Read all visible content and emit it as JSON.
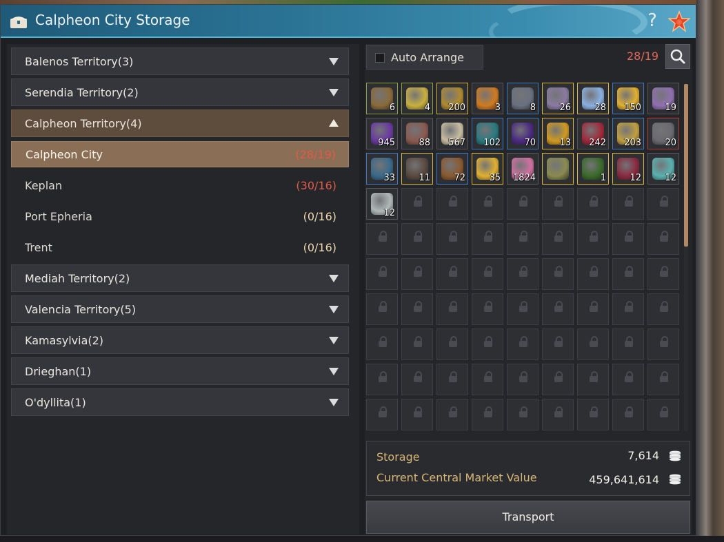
{
  "window": {
    "title": "Calpheon City Storage",
    "help_label": "?"
  },
  "territories": [
    {
      "label": "Balenos Territory(3)",
      "open": false
    },
    {
      "label": "Serendia Territory(2)",
      "open": false
    },
    {
      "label": "Calpheon Territory(4)",
      "open": true,
      "towns": [
        {
          "label": "Calpheon City",
          "count": "(28/19)",
          "active": true,
          "over": true
        },
        {
          "label": "Keplan",
          "count": "(30/16)",
          "active": false,
          "over": true
        },
        {
          "label": "Port Epheria",
          "count": "(0/16)",
          "active": false,
          "over": false
        },
        {
          "label": "Trent",
          "count": "(0/16)",
          "active": false,
          "over": false
        }
      ]
    },
    {
      "label": "Mediah Territory(2)",
      "open": false
    },
    {
      "label": "Valencia Territory(5)",
      "open": false
    },
    {
      "label": "Kamasylvia(2)",
      "open": false
    },
    {
      "label": "Drieghan(1)",
      "open": false
    },
    {
      "label": "O'dyllita(1)",
      "open": false
    }
  ],
  "storage": {
    "auto_arrange_label": "Auto Arrange",
    "auto_arrange_checked": false,
    "slot_count": "28/19",
    "items": [
      {
        "qty": "6",
        "icon": "bronze-key-icon",
        "border": "g",
        "color": "#8a6a3a"
      },
      {
        "qty": "4",
        "icon": "gold-key-icon",
        "border": "g",
        "color": "#c8b040"
      },
      {
        "qty": "200",
        "icon": "gold-emblem-icon",
        "border": "y",
        "color": "#b08a30"
      },
      {
        "qty": "3",
        "icon": "fire-orb-icon",
        "border": "",
        "color": "#d07a20"
      },
      {
        "qty": "8",
        "icon": "cloth-icon",
        "border": "b",
        "color": "#6a7080"
      },
      {
        "qty": "26",
        "icon": "crystal-icon",
        "border": "y",
        "color": "#8a7aa0"
      },
      {
        "qty": "28",
        "icon": "gift-bag-icon",
        "border": "y",
        "color": "#8ab0e0"
      },
      {
        "qty": "150",
        "icon": "gold-feather-icon",
        "border": "b",
        "color": "#e0b030"
      },
      {
        "qty": "19",
        "icon": "purple-scroll-icon",
        "border": "",
        "color": "#9070b0"
      },
      {
        "qty": "945",
        "icon": "purple-stone-icon",
        "border": "",
        "color": "#6a3aa0"
      },
      {
        "qty": "88",
        "icon": "ore-icon",
        "border": "",
        "color": "#8a5a50"
      },
      {
        "qty": "567",
        "icon": "paper-icon",
        "border": "",
        "color": "#c8bca0"
      },
      {
        "qty": "102",
        "icon": "teal-crystal-icon",
        "border": "b",
        "color": "#2a7a80"
      },
      {
        "qty": "70",
        "icon": "dark-stone-icon",
        "border": "b",
        "color": "#4a2a80"
      },
      {
        "qty": "13",
        "icon": "gold-medal-icon",
        "border": "y",
        "color": "#d09a20"
      },
      {
        "qty": "242",
        "icon": "red-shard-icon",
        "border": "",
        "color": "#a02a3a"
      },
      {
        "qty": "203",
        "icon": "gold-flask-icon",
        "border": "b",
        "color": "#c0a040"
      },
      {
        "qty": "20",
        "icon": "grey-stone-icon",
        "border": "r",
        "color": "#6a6a70"
      },
      {
        "qty": "33",
        "icon": "chest-icon",
        "border": "b",
        "color": "#3a6a8a"
      },
      {
        "qty": "11",
        "icon": "grave-cross-icon",
        "border": "y",
        "color": "#5a4a40"
      },
      {
        "qty": "72",
        "icon": "lantern-icon",
        "border": "b",
        "color": "#8a5a30"
      },
      {
        "qty": "35",
        "icon": "gold-bar-icon",
        "border": "y",
        "color": "#e0b030"
      },
      {
        "qty": "1824",
        "icon": "pink-gem-icon",
        "border": "",
        "color": "#d070a0"
      },
      {
        "qty": "",
        "icon": "wings-icon",
        "border": "y",
        "color": "#8a8a50"
      },
      {
        "qty": "1",
        "icon": "green-orb-icon",
        "border": "y",
        "color": "#3a6a2a"
      },
      {
        "qty": "12",
        "icon": "red-crystal-icon",
        "border": "y",
        "color": "#8a2a40"
      },
      {
        "qty": "12",
        "icon": "teal-gem-icon",
        "border": "",
        "color": "#5ab0b0"
      },
      {
        "qty": "12",
        "icon": "silver-gem-icon",
        "border": "",
        "color": "#b0b8b8"
      }
    ],
    "total_slots": 90
  },
  "values": {
    "storage_label": "Storage",
    "storage_value": "7,614",
    "market_label": "Current Central Market Value",
    "market_value": "459,641,614"
  },
  "transport_label": "Transport"
}
